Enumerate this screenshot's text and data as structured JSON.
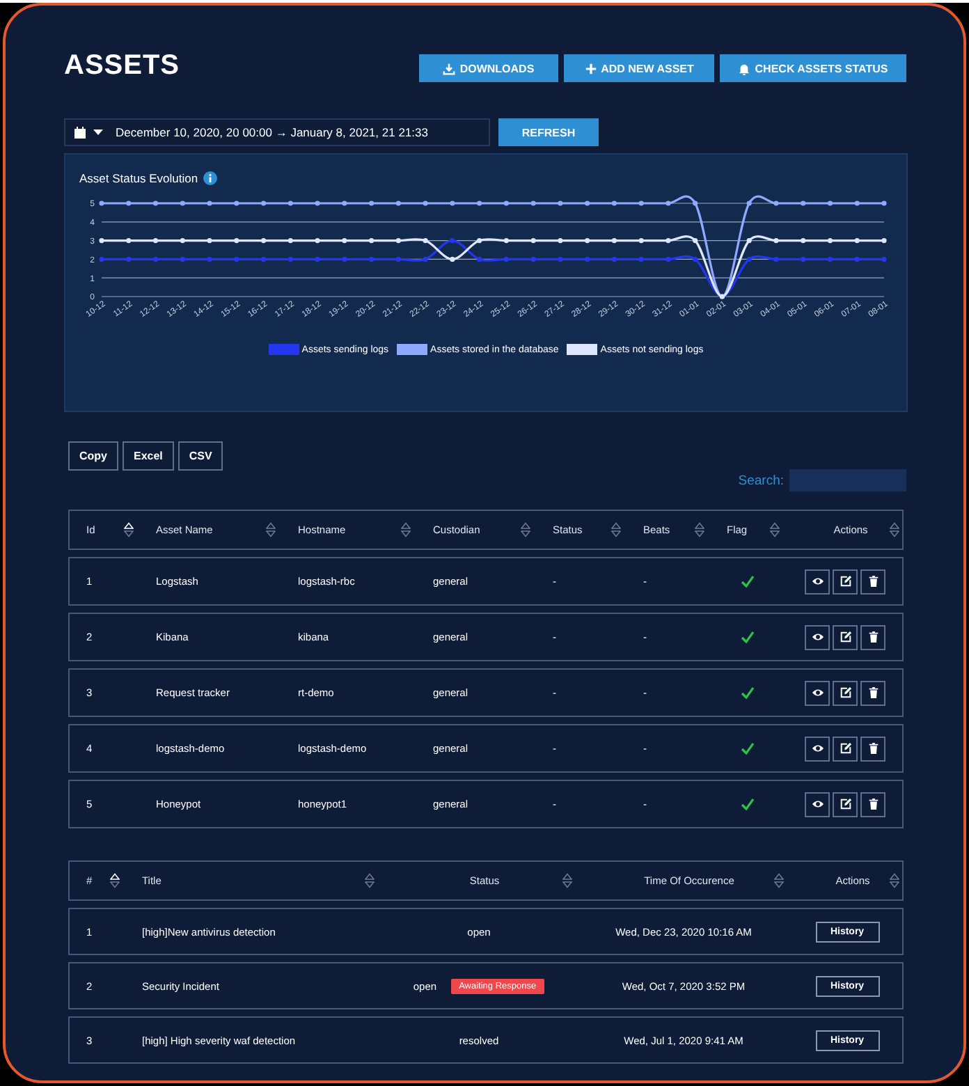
{
  "title": "ASSETS",
  "header_buttons": [
    "DOWNLOADS",
    "ADD NEW ASSET",
    "CHECK ASSETS STATUS"
  ],
  "date_range": {
    "value": "December 10, 2020, 20 00:00 → January 8, 2021, 21 21:33"
  },
  "refresh_button": "REFRESH",
  "chart": {
    "title": "Asset Status Evolution",
    "chart_data": {
      "type": "line",
      "categories": [
        "10-12",
        "11-12",
        "12-12",
        "13-12",
        "14-12",
        "15-12",
        "16-12",
        "17-12",
        "18-12",
        "19-12",
        "20-12",
        "21-12",
        "22-12",
        "23-12",
        "24-12",
        "25-12",
        "26-12",
        "27-12",
        "28-12",
        "29-12",
        "30-12",
        "31-12",
        "01-01",
        "02-01",
        "03-01",
        "04-01",
        "05-01",
        "06-01",
        "07-01",
        "08-01"
      ],
      "yticks": [
        {
          "value": 0,
          "label": "0"
        },
        {
          "value": 1,
          "label": "1"
        },
        {
          "value": 2,
          "label": "2"
        },
        {
          "value": 3,
          "label": "3"
        },
        {
          "value": 4,
          "label": "4"
        },
        {
          "value": 5,
          "label": "5"
        }
      ],
      "ylim": [
        0,
        5
      ],
      "grid": true,
      "series": [
        {
          "name": "Assets sending logs",
          "color": "#2436f0",
          "marker": "circle",
          "values": [
            2,
            2,
            2,
            2,
            2,
            2,
            2,
            2,
            2,
            2,
            2,
            2,
            2,
            3,
            2,
            2,
            2,
            2,
            2,
            2,
            2,
            2,
            2,
            0,
            2,
            2,
            2,
            2,
            2,
            2
          ]
        },
        {
          "name": "Assets stored in the database",
          "color": "#8ea9ff",
          "marker": "circle",
          "values": [
            5,
            5,
            5,
            5,
            5,
            5,
            5,
            5,
            5,
            5,
            5,
            5,
            5,
            5,
            5,
            5,
            5,
            5,
            5,
            5,
            5,
            5,
            5,
            0,
            5,
            5,
            5,
            5,
            5,
            5
          ]
        },
        {
          "name": "Assets not sending logs",
          "color": "#dfe6ff",
          "marker": "circle",
          "values": [
            3,
            3,
            3,
            3,
            3,
            3,
            3,
            3,
            3,
            3,
            3,
            3,
            3,
            2,
            3,
            3,
            3,
            3,
            3,
            3,
            3,
            3,
            3,
            0,
            3,
            3,
            3,
            3,
            3,
            3
          ]
        }
      ]
    }
  },
  "export_buttons": [
    "Copy",
    "Excel",
    "CSV"
  ],
  "search": {
    "label": "Search:"
  },
  "assets_table": {
    "columns": [
      {
        "label": "Id",
        "sorted": true
      },
      {
        "label": "Asset Name",
        "sorted": false
      },
      {
        "label": "Hostname",
        "sorted": false
      },
      {
        "label": "Custodian",
        "sorted": false
      },
      {
        "label": "Status",
        "sorted": false
      },
      {
        "label": "Beats",
        "sorted": false
      },
      {
        "label": "Flag",
        "sorted": false
      },
      {
        "label": "Actions",
        "sorted": false
      }
    ],
    "rows": [
      {
        "id": "1",
        "name": "Logstash",
        "hostname": "logstash-rbc",
        "custodian": "general",
        "status": "-",
        "beats": "-",
        "flag": true
      },
      {
        "id": "2",
        "name": "Kibana",
        "hostname": "kibana",
        "custodian": "general",
        "status": "-",
        "beats": "-",
        "flag": true
      },
      {
        "id": "3",
        "name": "Request tracker",
        "hostname": "rt-demo",
        "custodian": "general",
        "status": "-",
        "beats": "-",
        "flag": true
      },
      {
        "id": "4",
        "name": "logstash-demo",
        "hostname": "logstash-demo",
        "custodian": "general",
        "status": "-",
        "beats": "-",
        "flag": true
      },
      {
        "id": "5",
        "name": "Honeypot",
        "hostname": "honeypot1",
        "custodian": "general",
        "status": "-",
        "beats": "-",
        "flag": true
      }
    ]
  },
  "incidents_table": {
    "columns": [
      {
        "label": "#",
        "sorted": true
      },
      {
        "label": "Title",
        "sorted": false
      },
      {
        "label": "Status",
        "sorted": false
      },
      {
        "label": "Time Of Occurence",
        "sorted": false
      },
      {
        "label": "Actions",
        "sorted": false
      }
    ],
    "rows": [
      {
        "id": "1",
        "title": "[high]New antivirus detection",
        "status": "open",
        "time": "Wed, Dec 23, 2020 10:16 AM",
        "action": "History"
      },
      {
        "id": "2",
        "title": "Security Incident",
        "status": "open",
        "badge": "Awaiting Response",
        "time": "Wed, Oct 7, 2020 3:52 PM",
        "action": "History"
      },
      {
        "id": "3",
        "title": "[high] High severity waf detection",
        "status": "resolved",
        "time": "Wed, Jul 1, 2020 9:41 AM",
        "action": "History"
      }
    ]
  }
}
